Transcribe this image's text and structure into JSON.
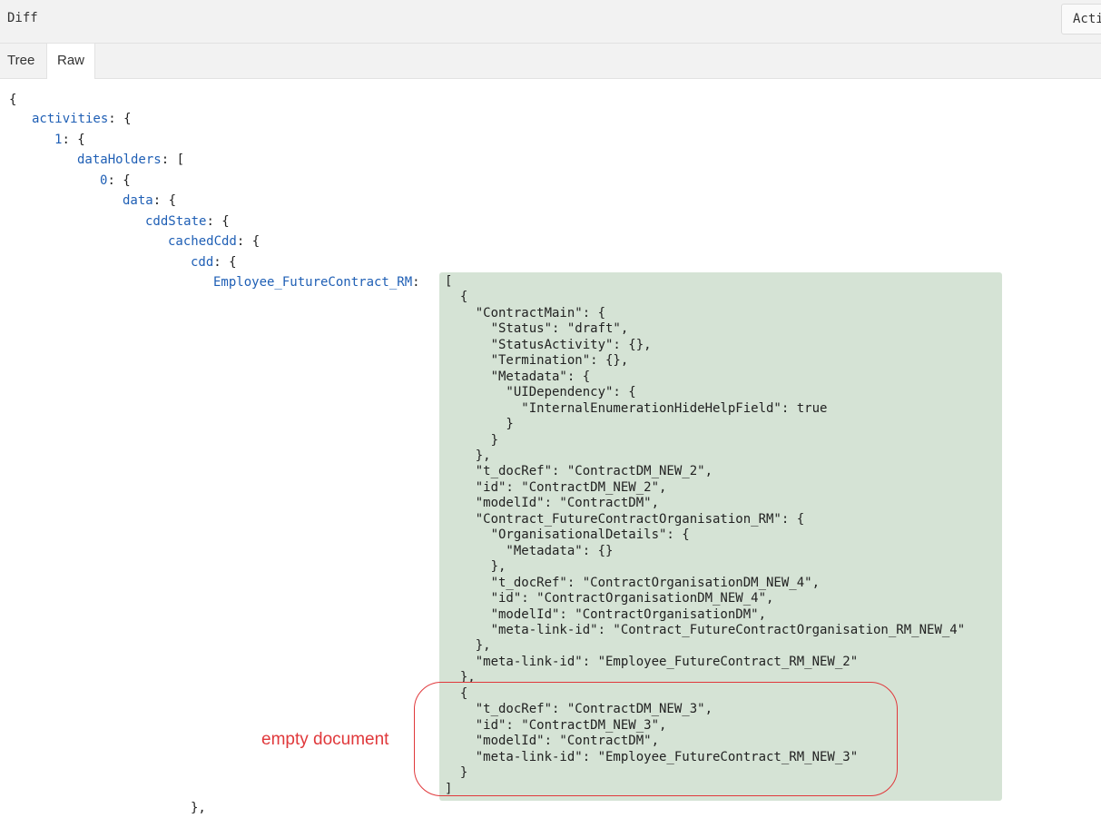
{
  "header": {
    "title": "Diff",
    "action_label": "Acti"
  },
  "tabs": [
    {
      "label": "Tree"
    },
    {
      "label": "Raw",
      "active": true
    }
  ],
  "tree_lines": [
    {
      "key": "",
      "suffix": "{"
    },
    {
      "key": "activities",
      "suffix": ": {"
    },
    {
      "key": "1",
      "suffix": ": {"
    },
    {
      "key": "dataHolders",
      "suffix": ": ["
    },
    {
      "key": "0",
      "suffix": ": {"
    },
    {
      "key": "data",
      "suffix": ": {"
    },
    {
      "key": "cddState",
      "suffix": ": {"
    },
    {
      "key": "cachedCdd",
      "suffix": ": {"
    },
    {
      "key": "cdd",
      "suffix": ": {"
    },
    {
      "key": "Employee_FutureContract_RM",
      "suffix": ":"
    }
  ],
  "trailing_line": "},",
  "raw_json": "[\n  {\n    \"ContractMain\": {\n      \"Status\": \"draft\",\n      \"StatusActivity\": {},\n      \"Termination\": {},\n      \"Metadata\": {\n        \"UIDependency\": {\n          \"InternalEnumerationHideHelpField\": true\n        }\n      }\n    },\n    \"t_docRef\": \"ContractDM_NEW_2\",\n    \"id\": \"ContractDM_NEW_2\",\n    \"modelId\": \"ContractDM\",\n    \"Contract_FutureContractOrganisation_RM\": {\n      \"OrganisationalDetails\": {\n        \"Metadata\": {}\n      },\n      \"t_docRef\": \"ContractOrganisationDM_NEW_4\",\n      \"id\": \"ContractOrganisationDM_NEW_4\",\n      \"modelId\": \"ContractOrganisationDM\",\n      \"meta-link-id\": \"Contract_FutureContractOrganisation_RM_NEW_4\"\n    },\n    \"meta-link-id\": \"Employee_FutureContract_RM_NEW_2\"\n  },\n  {\n    \"t_docRef\": \"ContractDM_NEW_3\",\n    \"id\": \"ContractDM_NEW_3\",\n    \"modelId\": \"ContractDM\",\n    \"meta-link-id\": \"Employee_FutureContract_RM_NEW_3\"\n  }\n]",
  "annotation": {
    "label": "empty document",
    "color": "#e0383b"
  },
  "colors": {
    "key": "#1f5fb5",
    "highlight": "#d5e3d5"
  }
}
